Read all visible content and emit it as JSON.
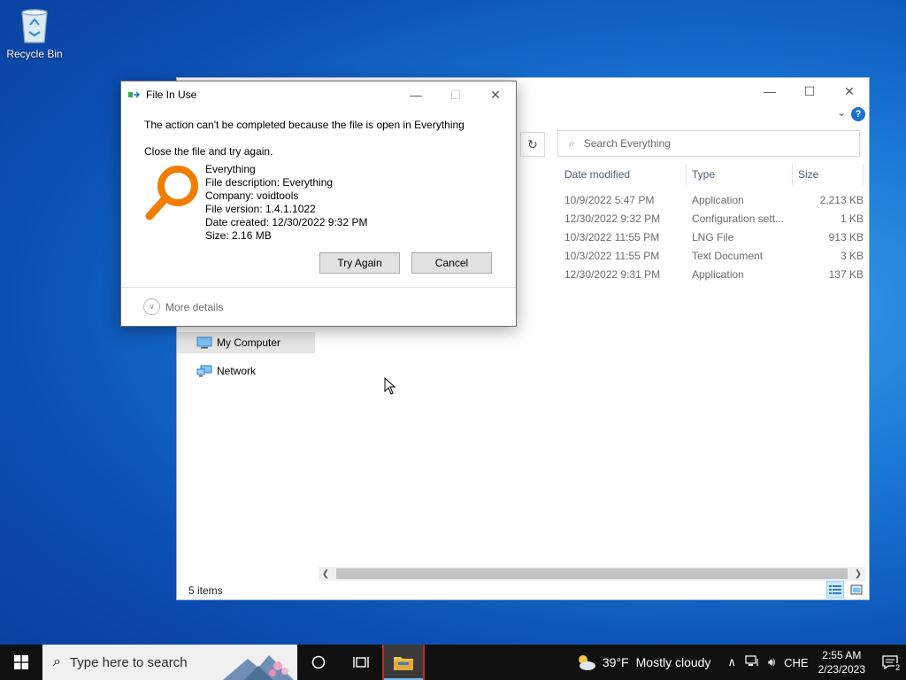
{
  "desktop": {
    "recycle_bin_label": "Recycle Bin"
  },
  "explorer": {
    "search_placeholder": "Search Everything",
    "columns": {
      "date": "Date modified",
      "type": "Type",
      "size": "Size"
    },
    "rows": [
      {
        "date": "10/9/2022 5:47 PM",
        "type": "Application",
        "size": "2,213 KB"
      },
      {
        "date": "12/30/2022 9:32 PM",
        "type": "Configuration sett...",
        "size": "1 KB"
      },
      {
        "date": "10/3/2022 11:55 PM",
        "type": "LNG File",
        "size": "913 KB"
      },
      {
        "date": "10/3/2022 11:55 PM",
        "type": "Text Document",
        "size": "3 KB"
      },
      {
        "date": "12/30/2022 9:31 PM",
        "type": "Application",
        "size": "137 KB"
      }
    ],
    "nav": {
      "my_computer": "My Computer",
      "network": "Network"
    },
    "status": "5 items"
  },
  "dialog": {
    "title": "File In Use",
    "message": "The action can't be completed because the file is open in Everything",
    "instruction": "Close the file and try again.",
    "file": {
      "name": "Everything",
      "description": "File description: Everything",
      "company": "Company: voidtools",
      "version": "File version: 1.4.1.1022",
      "created": "Date created: 12/30/2022 9:32 PM",
      "size": "Size: 2.16 MB"
    },
    "try_again": "Try Again",
    "cancel": "Cancel",
    "more_details": "More details"
  },
  "taskbar": {
    "search_placeholder": "Type here to search",
    "temperature": "39°F",
    "weather": "Mostly cloudy",
    "language": "CHE",
    "time": "2:55 AM",
    "date": "2/23/2023",
    "notification_count": "2"
  },
  "colors": {
    "accent": "#0078d7",
    "everything_orange": "#f07d00"
  }
}
